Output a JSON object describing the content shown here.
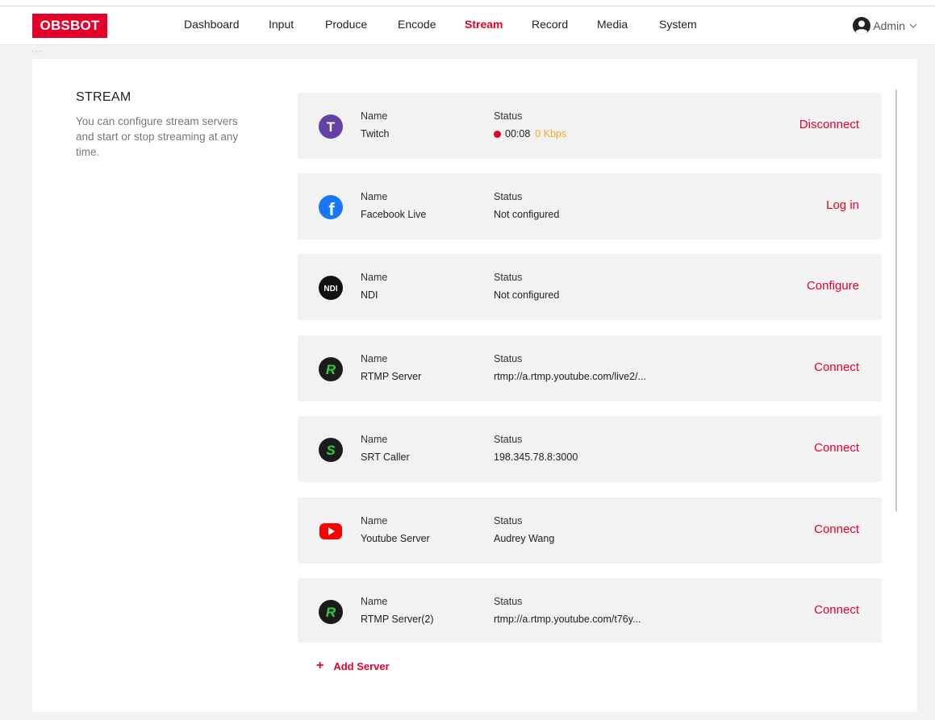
{
  "brand": {
    "logo": "OBSBOT",
    "accent": "#e4002b"
  },
  "nav": [
    {
      "label": "Dashboard"
    },
    {
      "label": "Input"
    },
    {
      "label": "Produce"
    },
    {
      "label": "Encode"
    },
    {
      "label": "Stream",
      "active": true
    },
    {
      "label": "Record"
    },
    {
      "label": "Media"
    },
    {
      "label": "System"
    }
  ],
  "user": {
    "name": "Admin",
    "icon": "user-avatar-icon"
  },
  "section": {
    "title": "STREAM",
    "description": "You can configure stream servers and start or stop streaming at any time."
  },
  "labels": {
    "name": "Name",
    "status": "Status"
  },
  "servers": [
    {
      "name": "Twitch",
      "status": "00:08",
      "bitrate": "0 Kbps",
      "live": true,
      "action": "Disconnect",
      "icon": "twitch-icon"
    },
    {
      "name": "Facebook Live",
      "status": "Not configured",
      "action": "Log in",
      "icon": "facebook-icon"
    },
    {
      "name": "NDI",
      "status": "Not configured",
      "action": "Configure",
      "icon": "ndi-icon"
    },
    {
      "name": "RTMP Server",
      "status": "rtmp://a.rtmp.youtube.com/live2/...",
      "action": "Connect",
      "icon": "rtmp-icon"
    },
    {
      "name": "SRT Caller",
      "status": "198.345.78.8:3000",
      "action": "Connect",
      "icon": "srt-icon"
    },
    {
      "name": "Youtube Server",
      "status": "Audrey Wang",
      "action": "Connect",
      "icon": "youtube-icon"
    },
    {
      "name": "RTMP Server(2)",
      "status": "rtmp://a.rtmp.youtube.com/t76y...",
      "action": "Connect",
      "icon": "rtmp-icon"
    }
  ],
  "add_server": {
    "label": "Add Server"
  }
}
